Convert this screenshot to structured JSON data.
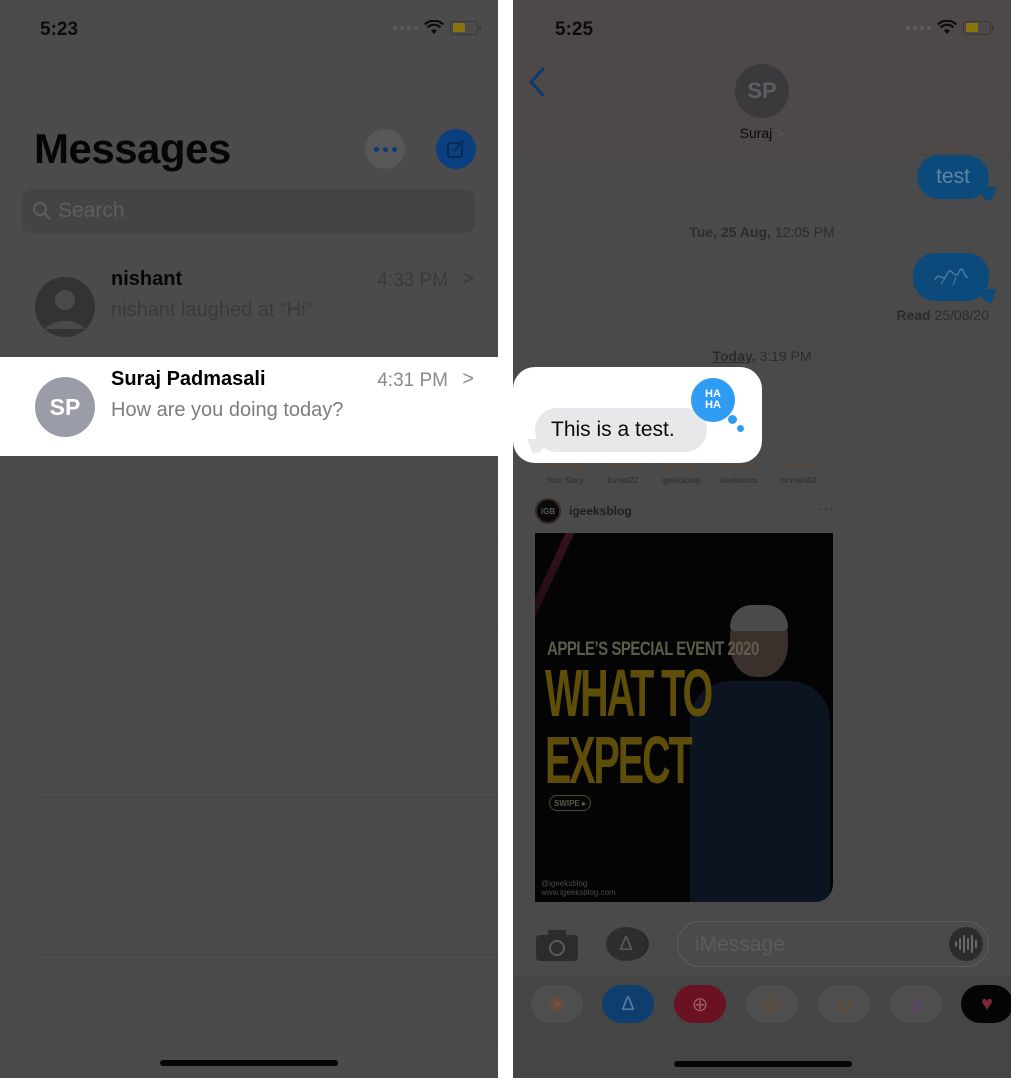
{
  "left_screen": {
    "status_bar": {
      "time": "5:23"
    },
    "title": "Messages",
    "more_button_icon": "ellipsis-icon",
    "compose_button_icon": "compose-icon",
    "search": {
      "placeholder": "Search",
      "icon": "search-icon"
    },
    "conversations": [
      {
        "name": "nishant",
        "time": "4:33 PM",
        "preview": "nishant laughed at “Hi”",
        "avatar_type": "person-placeholder",
        "highlighted": false
      },
      {
        "name": "Suraj Padmasali",
        "time": "4:31 PM",
        "preview": "How are you doing today?",
        "avatar_initials": "SP",
        "highlighted": true
      }
    ],
    "chevron": ">"
  },
  "right_screen": {
    "status_bar": {
      "time": "5:25"
    },
    "header": {
      "back_glyph": "<",
      "avatar_initials": "SP",
      "contact_name": "Suraj",
      "chevron": ">"
    },
    "messages": [
      {
        "direction": "outgoing",
        "type": "text",
        "text": "test"
      },
      {
        "type": "timestamp",
        "day": "Tue, 25 Aug,",
        "time": "12:05 PM"
      },
      {
        "direction": "outgoing",
        "type": "handwriting",
        "text": "~handwritten~"
      },
      {
        "type": "read_receipt",
        "label": "Read",
        "date": "25/08/20"
      },
      {
        "type": "timestamp",
        "day": "Today,",
        "time": "3:19 PM"
      },
      {
        "direction": "incoming",
        "type": "text",
        "text": "This is a test.",
        "reaction": {
          "label_top": "HA",
          "label_bottom": "HA",
          "name": "haha",
          "color": "#2f9cf3"
        }
      }
    ],
    "shared_post": {
      "stories": [
        "Your Story",
        "kunalt22",
        "igeeksblog",
        "beebomco",
        "mr.mahi92"
      ],
      "username": "igeeksblog",
      "avatar_text": "iGB",
      "more": "···",
      "image": {
        "kicker": "APPLE’S SPECIAL EVENT 2020",
        "headline_line1": "WHAT TO",
        "headline_line2": "EXPECT",
        "swipe_label": "SWIPE ▸",
        "credit_line1": "@igeeksblog",
        "credit_line2": "www.igeeksblog.com"
      }
    },
    "compose": {
      "placeholder": "iMessage",
      "camera_icon": "camera-icon",
      "apps_icon": "app-store-icon",
      "audio_icon": "waveform-icon"
    },
    "app_drawer": [
      {
        "name": "photos",
        "glyph": "❀",
        "bg": "#4e4e4e",
        "color": "#7a4a3a"
      },
      {
        "name": "app-store",
        "glyph": "∆",
        "bg": "#0d3e6e",
        "color": "#5a7a9a"
      },
      {
        "name": "web-images",
        "glyph": "⊕",
        "bg": "#6a1222",
        "color": "#9a5a62"
      },
      {
        "name": "animoji",
        "glyph": "☹",
        "bg": "#4e4e4e",
        "color": "#6a4a2a"
      },
      {
        "name": "memoji",
        "glyph": "☺",
        "bg": "#4e4e4e",
        "color": "#6a4a2a"
      },
      {
        "name": "music",
        "glyph": "♫",
        "bg": "#4e4e4e",
        "color": "#6a3a7a"
      },
      {
        "name": "digital-touch",
        "glyph": "♥",
        "bg": "#050505",
        "color": "#7a2a3a"
      }
    ]
  },
  "colors": {
    "dim_overlay_bg": "#4b4b4b",
    "highlight_bg": "#ffffff",
    "ios_blue_dimmed": "#0a3f80",
    "outgoing_bubble_dimmed": "#0b4a7a",
    "incoming_bubble": "#e8e8ea",
    "reaction_blue": "#2f9cf3",
    "avatar_gray": "#9a9ca7"
  }
}
